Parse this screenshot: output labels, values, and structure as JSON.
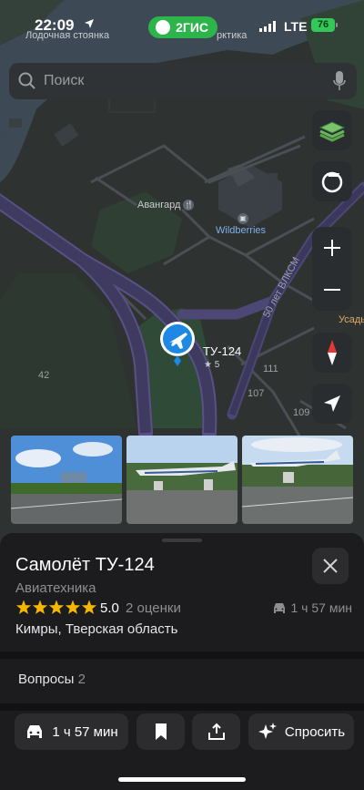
{
  "status_bar": {
    "time": "22:09",
    "app_badge": "2ГИС",
    "network": "LTE",
    "battery": "76"
  },
  "search": {
    "placeholder": "Поиск"
  },
  "map": {
    "labels": {
      "boat_parking": "Лодочная стоянка",
      "arctic": "рктика",
      "avangard": "Авангард",
      "wildberries": "Wildberries",
      "street": "50 лет ВЛКСМ",
      "usad": "Усадь",
      "marker_name": "ТУ-124",
      "marker_rating": "★ 5",
      "num_42": "42",
      "num_111": "111",
      "num_107": "107",
      "num_109": "109"
    }
  },
  "place": {
    "title": "Самолёт ТУ-124",
    "category": "Авиатехника",
    "rating_value": "5.0",
    "rating_stars": 5,
    "rating_count": "2 оценки",
    "eta": "1 ч 57 мин",
    "address": "Кимры, Тверская область"
  },
  "questions": {
    "label": "Вопросы",
    "count": "2"
  },
  "actions": {
    "route_label": "1 ч 57 мин",
    "ask_label": "Спросить"
  },
  "colors": {
    "brand_green": "#2db44a",
    "star_yellow": "#f5b800",
    "marker_blue": "#1e88e5",
    "battery_green": "#34c759"
  }
}
